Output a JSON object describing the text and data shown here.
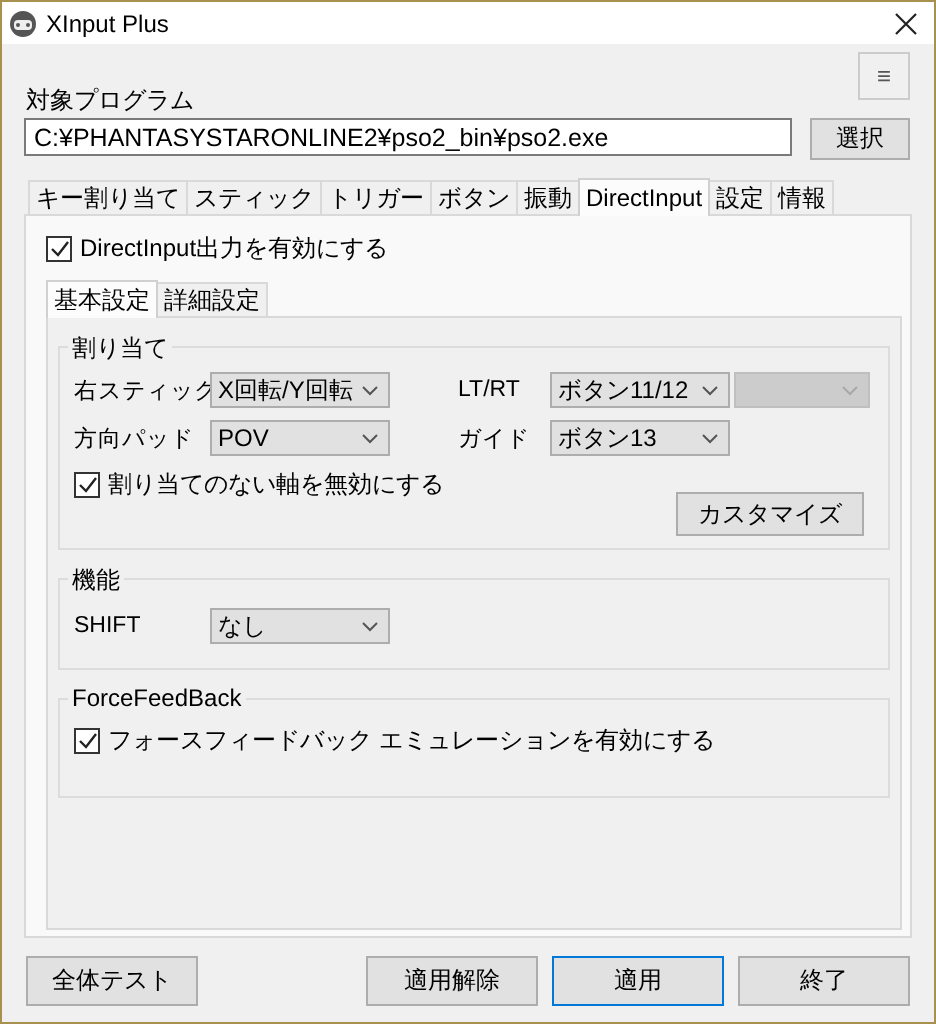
{
  "window": {
    "title": "XInput Plus"
  },
  "menu_button": {
    "label": "≡"
  },
  "target_program": {
    "label": "対象プログラム",
    "value": "C:¥PHANTASYSTARONLINE2¥pso2_bin¥pso2.exe",
    "browse_button": "選択"
  },
  "tabs": [
    {
      "label": "キー割り当て",
      "selected": false
    },
    {
      "label": "スティック",
      "selected": false
    },
    {
      "label": "トリガー",
      "selected": false
    },
    {
      "label": "ボタン",
      "selected": false
    },
    {
      "label": "振動",
      "selected": false
    },
    {
      "label": "DirectInput",
      "selected": true
    },
    {
      "label": "設定",
      "selected": false
    },
    {
      "label": "情報",
      "selected": false
    }
  ],
  "directinput": {
    "enable": {
      "label": "DirectInput出力を有効にする",
      "checked": true
    },
    "subtabs": [
      {
        "label": "基本設定",
        "selected": true
      },
      {
        "label": "詳細設定",
        "selected": false
      }
    ],
    "assignment": {
      "title": "割り当て",
      "fields": [
        {
          "label": "右スティック",
          "dropdowns": [
            {
              "value": "X回転/Y回転",
              "disabled": false
            }
          ]
        },
        {
          "label": "LT/RT",
          "dropdowns": [
            {
              "value": "ボタン11/12",
              "disabled": false
            },
            {
              "disabled": true
            }
          ]
        },
        {
          "label": "方向パッド",
          "dropdowns": [
            {
              "value": "POV",
              "disabled": false
            }
          ]
        },
        {
          "label": "ガイド",
          "dropdowns": [
            {
              "value": "ボタン13",
              "disabled": false
            }
          ]
        }
      ],
      "disable_unassigned": {
        "label": "割り当てのない軸を無効にする",
        "checked": true
      },
      "customize_button": "カスタマイズ"
    },
    "function": {
      "title": "機能",
      "fields": [
        {
          "label": "SHIFT",
          "dropdowns": [
            {
              "value": "なし",
              "disabled": false
            }
          ]
        }
      ]
    },
    "force_feedback": {
      "title": "ForceFeedBack",
      "emulation": {
        "label": "フォースフィードバック エミュレーションを有効にする",
        "checked": true
      }
    }
  },
  "buttons": [
    {
      "label": "全体テスト",
      "focused": false
    },
    {
      "label": "適用解除",
      "focused": false
    },
    {
      "label": "適用",
      "focused": true
    },
    {
      "label": "終了",
      "focused": false
    }
  ]
}
